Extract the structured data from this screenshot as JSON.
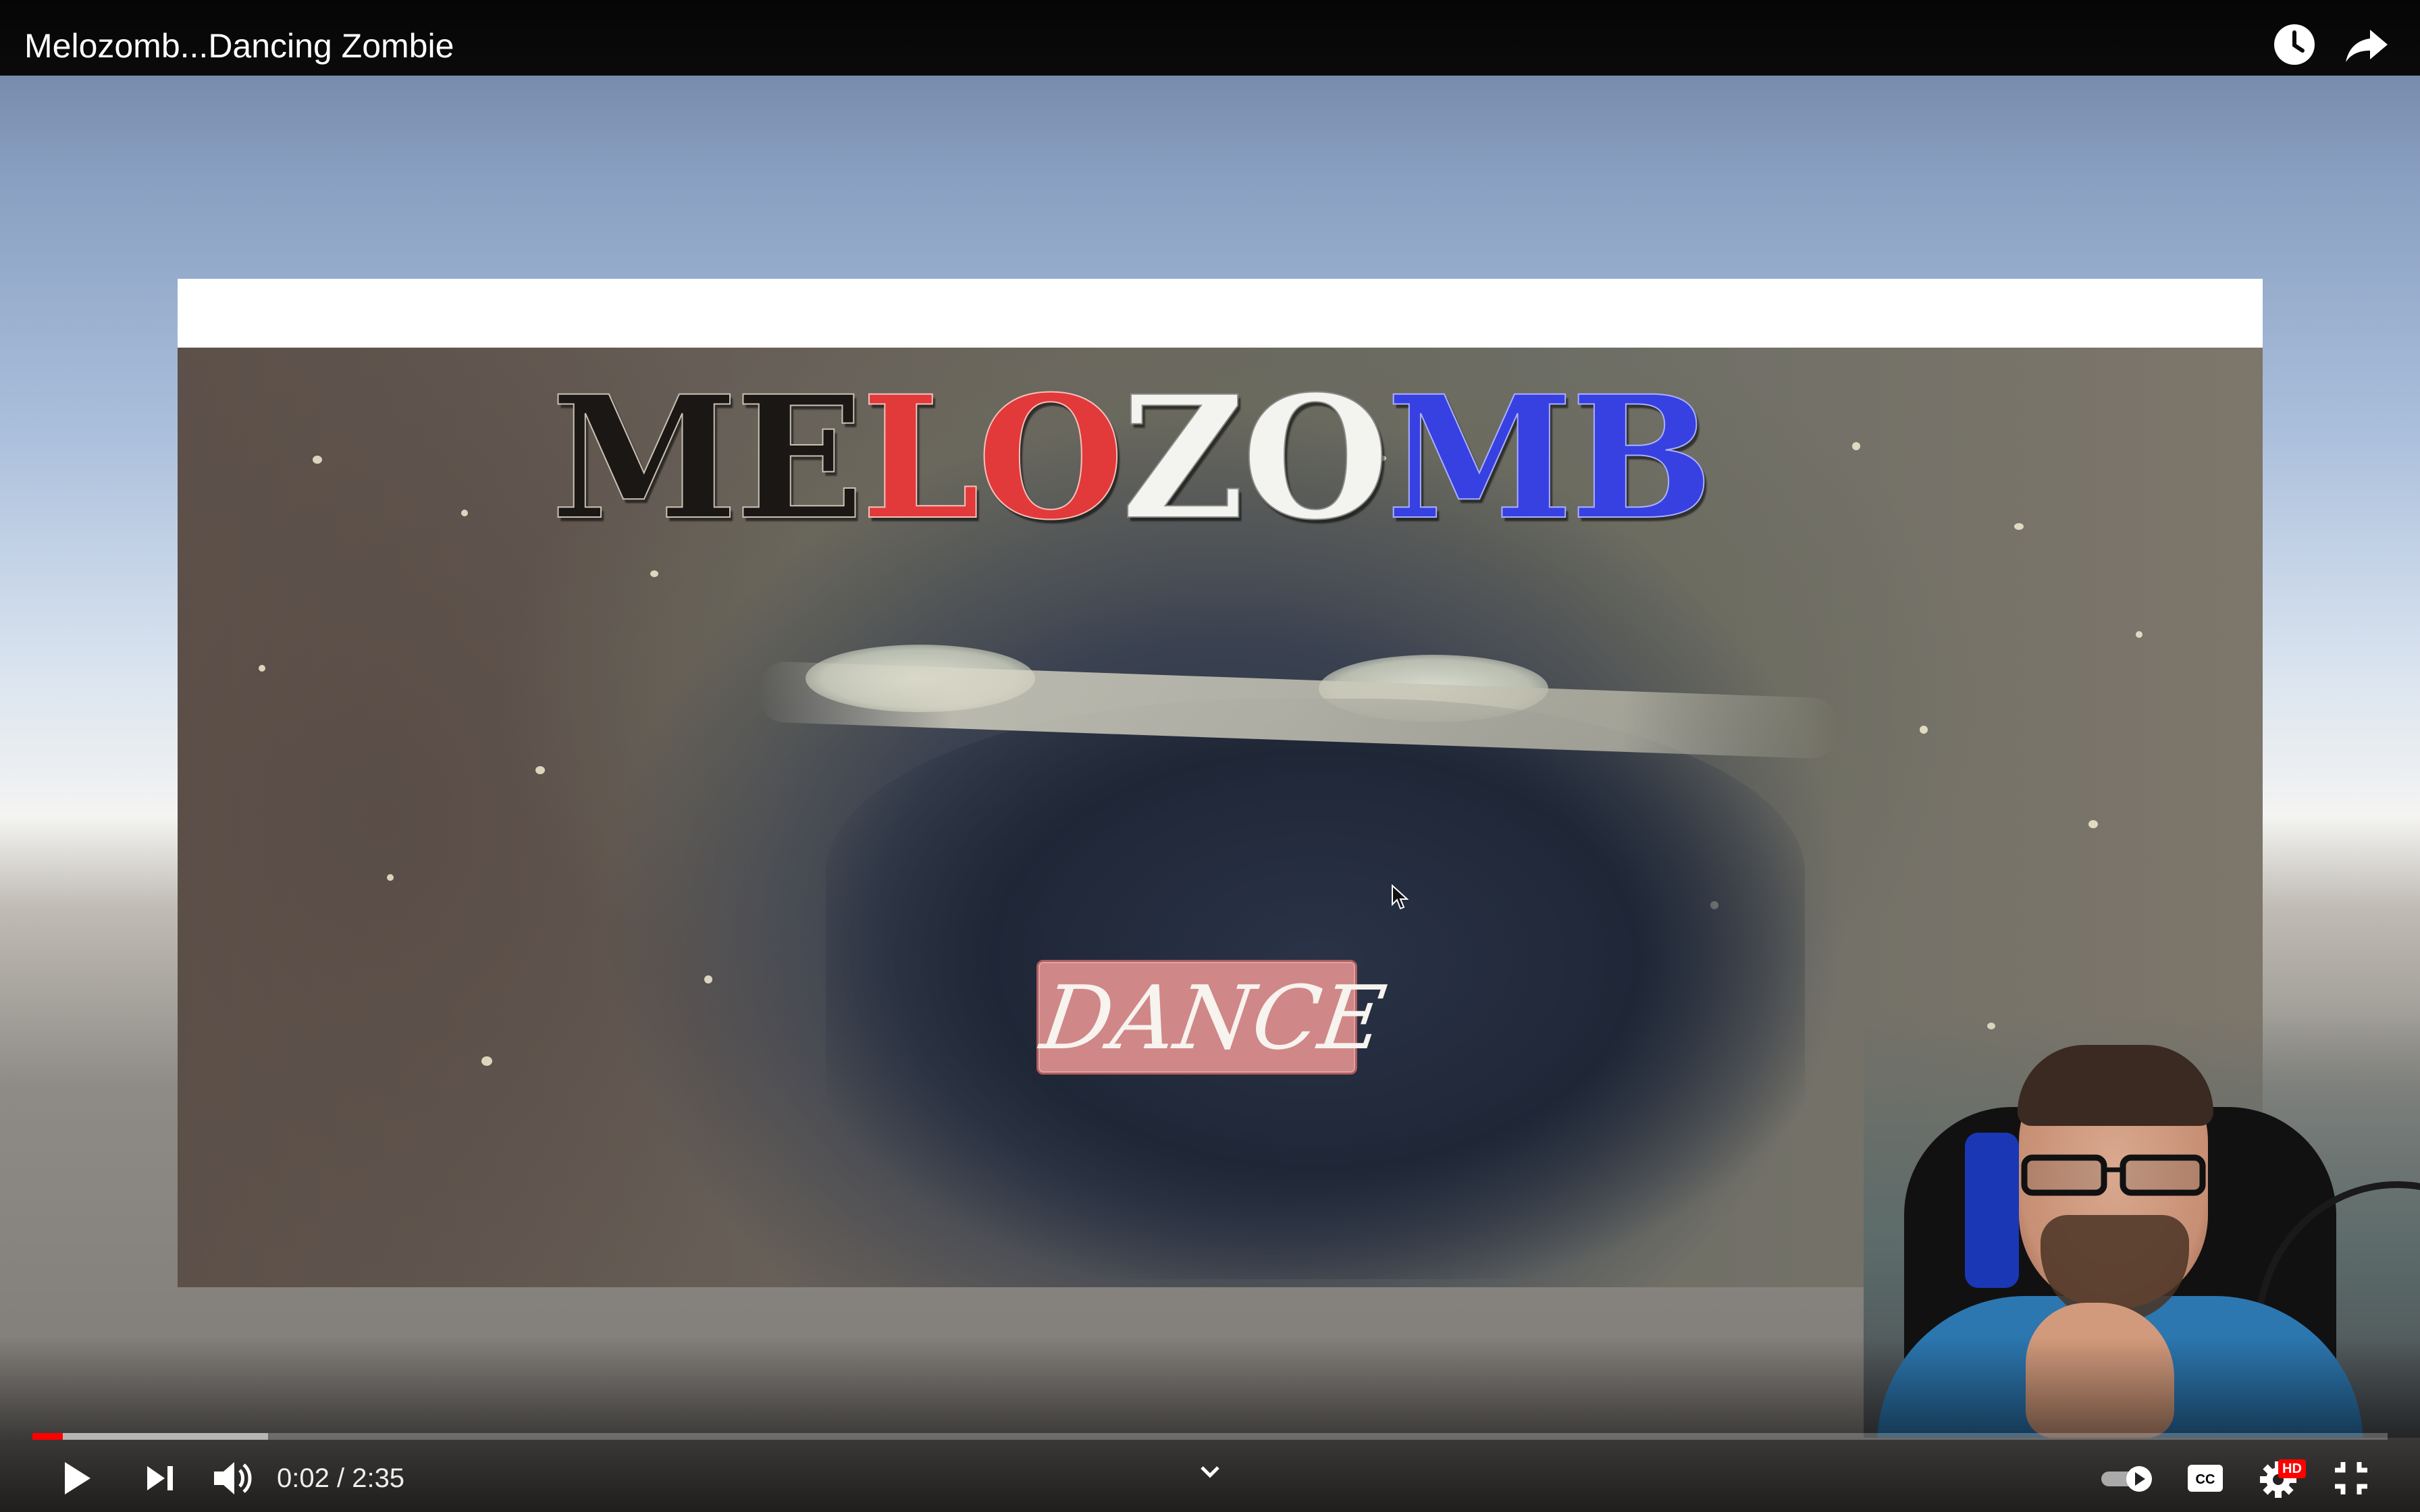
{
  "player": {
    "title": "Melozomb...Dancing Zombie",
    "time_current": "0:02",
    "time_separator": " / ",
    "time_total": "2:35",
    "progress_played": 0.013,
    "progress_buffered": 0.1,
    "hd_badge": "HD"
  },
  "icons": {
    "watch_later": "clock-icon",
    "share": "share-arrow-icon",
    "play": "play-icon",
    "next": "next-icon",
    "volume": "volume-icon",
    "chapters": "chevron-down-icon",
    "autoplay": "autoplay-toggle-icon",
    "captions": "cc-icon",
    "settings": "gear-icon",
    "fullscreen_exit": "exit-fullscreen-icon"
  },
  "game": {
    "logo_letters": [
      {
        "ch": "M",
        "color": "black"
      },
      {
        "ch": "E",
        "color": "black"
      },
      {
        "ch": "L",
        "color": "red"
      },
      {
        "ch": "O",
        "color": "red"
      },
      {
        "ch": "Z",
        "color": "white"
      },
      {
        "ch": "O",
        "color": "white"
      },
      {
        "ch": "M",
        "color": "blue"
      },
      {
        "ch": "B",
        "color": "blue"
      }
    ],
    "dance_button": "DANCE"
  },
  "colors": {
    "progress": "#ff0000",
    "logo_red": "#e2393a",
    "logo_blue": "#3740e0",
    "dance_button": "#d08787"
  }
}
